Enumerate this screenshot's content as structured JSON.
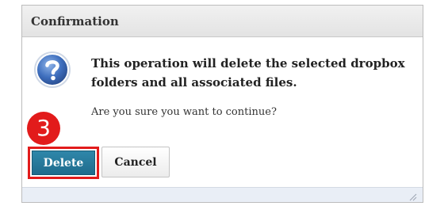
{
  "dialog": {
    "title": "Confirmation",
    "icon": "question-icon",
    "message_line1": "This operation will delete the selected dropbox",
    "message_line2": "folders and all associated files.",
    "prompt": "Are you sure you want to continue?",
    "step_badge": "3",
    "delete_label": "Delete",
    "cancel_label": "Cancel"
  },
  "colors": {
    "accent": "#1f6b8c",
    "highlight": "#e21b1b",
    "footer": "#e9eef6"
  }
}
